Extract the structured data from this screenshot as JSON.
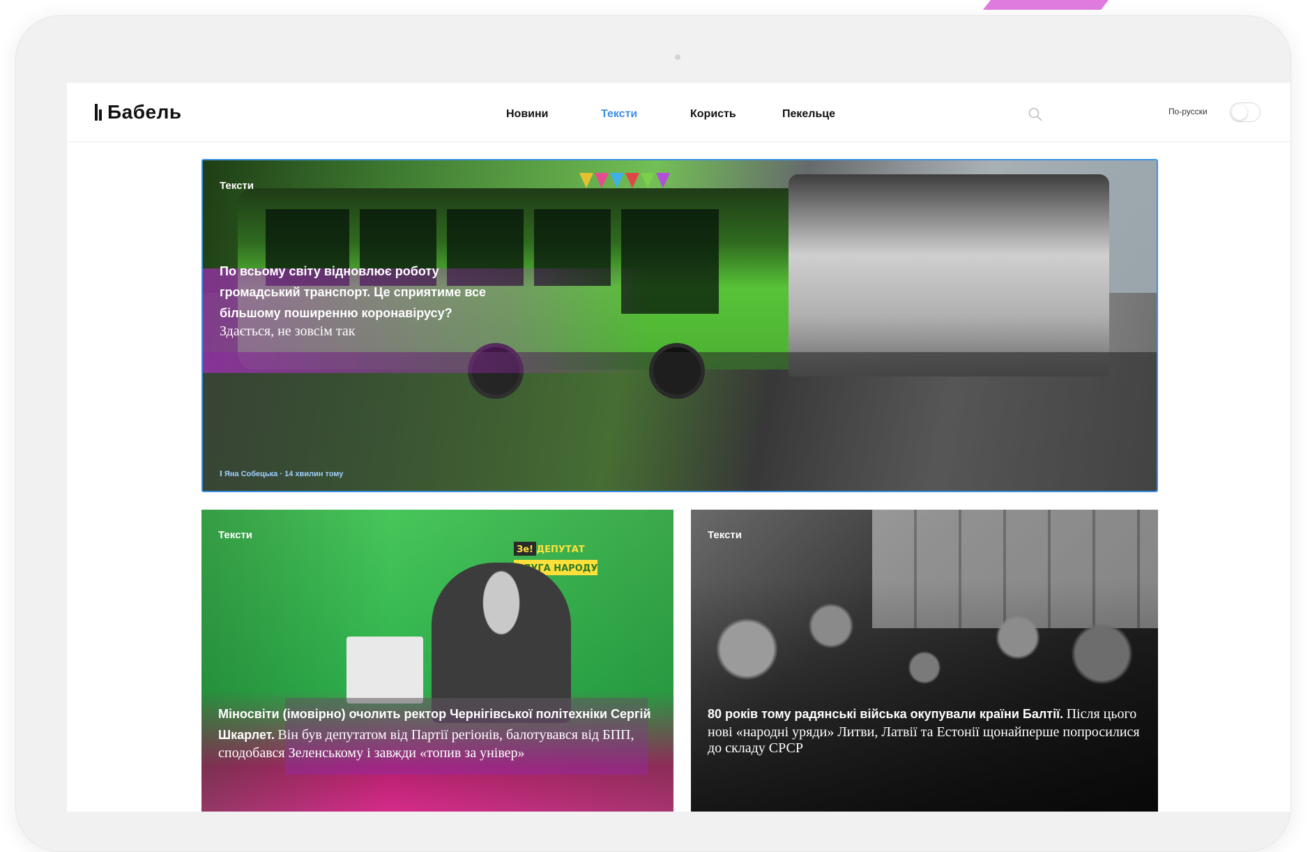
{
  "site": {
    "logo": "Бабель",
    "nav": [
      {
        "label": "Новини",
        "active": false
      },
      {
        "label": "Тексти",
        "active": true
      },
      {
        "label": "Користь",
        "active": false
      },
      {
        "label": "Пекельце",
        "active": false
      }
    ],
    "search_icon": "search-icon",
    "language_label": "По-русски",
    "language_toggle_on": false
  },
  "articles": [
    {
      "tag": "Тексти",
      "title": "По всьому світу відновлює роботу громадський транспорт. Це сприятиме все більшому поширенню коронавірусу?",
      "subtitle": "Здається, не зовсім так",
      "author": "Яна Собецька",
      "time": "14 хвилин тому",
      "separator": "·"
    },
    {
      "tag": "Тексти",
      "title": "Міносвіти (імовірно) очолить ректор Чернігівської політехніки Сергій Шкарлет.",
      "subtitle": "Він був депутатом від Партії регіонів, балотувався від БПП, сподобався Зеленському і завжди «топив за універ»",
      "sign_line1": "Зе! ДЕПУТАТ",
      "sign_line2": "СЛУГА НАРОДУ"
    },
    {
      "tag": "Тексти",
      "title": "80 років тому радянські війська окупували країни Балтії.",
      "subtitle": "Після цього нові «народні уряди» Литви, Латвії та Естонії щонайперше попросилися до складу СРСР"
    }
  ],
  "colors": {
    "accent": "#3d8fe6",
    "brand_pink": "#e07ce0",
    "hero_green": "#58c238"
  }
}
